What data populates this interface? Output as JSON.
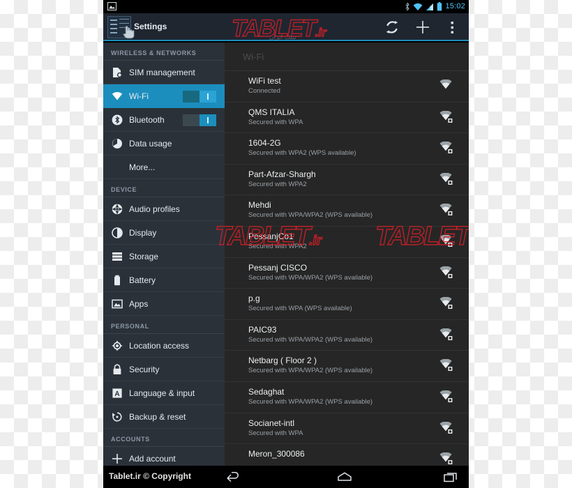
{
  "status_bar": {
    "notification_icon": "image-icon",
    "icons": [
      "bluetooth-icon",
      "wifi-icon",
      "signal-icon",
      "battery-icon"
    ],
    "clock": "15:02"
  },
  "action_bar": {
    "app_icon": "settings-app-icon",
    "title": "Settings",
    "buttons": [
      {
        "name": "scan-button",
        "icon": "refresh-scan-icon"
      },
      {
        "name": "add-network-button",
        "icon": "plus-icon"
      },
      {
        "name": "overflow-menu-button",
        "icon": "more-vertical-icon"
      }
    ]
  },
  "sidebar": {
    "sections": [
      {
        "header": "WIRELESS & NETWORKS",
        "items": [
          {
            "label": "SIM management",
            "icon": "sim-card-icon",
            "selected": false,
            "toggle": null
          },
          {
            "label": "Wi-Fi",
            "icon": "wifi-icon",
            "selected": true,
            "toggle": "on"
          },
          {
            "label": "Bluetooth",
            "icon": "bluetooth-icon",
            "selected": false,
            "toggle": "on"
          },
          {
            "label": "Data usage",
            "icon": "pie-chart-icon",
            "selected": false,
            "toggle": null
          },
          {
            "label": "More...",
            "icon": null,
            "selected": false,
            "toggle": null
          }
        ]
      },
      {
        "header": "DEVICE",
        "items": [
          {
            "label": "Audio profiles",
            "icon": "audio-profiles-icon",
            "selected": false,
            "toggle": null
          },
          {
            "label": "Display",
            "icon": "brightness-icon",
            "selected": false,
            "toggle": null
          },
          {
            "label": "Storage",
            "icon": "storage-icon",
            "selected": false,
            "toggle": null
          },
          {
            "label": "Battery",
            "icon": "battery-icon",
            "selected": false,
            "toggle": null
          },
          {
            "label": "Apps",
            "icon": "apps-image-icon",
            "selected": false,
            "toggle": null
          }
        ]
      },
      {
        "header": "PERSONAL",
        "items": [
          {
            "label": "Location access",
            "icon": "location-crosshair-icon",
            "selected": false,
            "toggle": null
          },
          {
            "label": "Security",
            "icon": "lock-icon",
            "selected": false,
            "toggle": null
          },
          {
            "label": "Language & input",
            "icon": "language-a-icon",
            "selected": false,
            "toggle": null
          },
          {
            "label": "Backup & reset",
            "icon": "backup-restore-icon",
            "selected": false,
            "toggle": null
          }
        ]
      },
      {
        "header": "ACCOUNTS",
        "items": [
          {
            "label": "Add account",
            "icon": "plus-icon",
            "selected": false,
            "toggle": null
          }
        ]
      }
    ]
  },
  "content": {
    "title": "Wi-Fi",
    "networks": [
      {
        "ssid": "WiFi test",
        "status": "Connected",
        "signal": "wifi-signal-icon"
      },
      {
        "ssid": "QMS ITALIA",
        "status": "Secured with WPA",
        "signal": "wifi-signal-lock-icon"
      },
      {
        "ssid": "1604-2G",
        "status": "Secured with WPA2 (WPS available)",
        "signal": "wifi-signal-lock-icon"
      },
      {
        "ssid": "Part-Afzar-Shargh",
        "status": "Secured with WPA2",
        "signal": "wifi-signal-lock-icon"
      },
      {
        "ssid": "Mehdi",
        "status": "Secured with WPA/WPA2 (WPS available)",
        "signal": "wifi-signal-lock-icon"
      },
      {
        "ssid": "PessanjCo1",
        "status": "Secured with WPA2",
        "signal": "wifi-signal-lock-icon"
      },
      {
        "ssid": "Pessanj CISCO",
        "status": "Secured with WPA/WPA2 (WPS available)",
        "signal": "wifi-signal-lock-icon"
      },
      {
        "ssid": "p.g",
        "status": "Secured with WPA (WPS available)",
        "signal": "wifi-signal-lock-icon"
      },
      {
        "ssid": "PAIC93",
        "status": "Secured with WPA/WPA2 (WPS available)",
        "signal": "wifi-signal-lock-icon"
      },
      {
        "ssid": "Netbarg ( Floor 2 )",
        "status": "Secured with WPA/WPA2 (WPS available)",
        "signal": "wifi-signal-lock-icon"
      },
      {
        "ssid": "Sedaghat",
        "status": "Secured with WPA/WPA2 (WPS available)",
        "signal": "wifi-signal-lock-icon"
      },
      {
        "ssid": "Socianet-intl",
        "status": "Secured with WPA",
        "signal": "wifi-signal-lock-icon"
      },
      {
        "ssid": "Meron_300086",
        "status": "",
        "signal": "wifi-signal-lock-icon"
      }
    ]
  },
  "bottom_bar": {
    "copyright": "Tablet.ir © Copyright",
    "nav": [
      {
        "name": "nav-back-button",
        "icon": "back-arrow-icon"
      },
      {
        "name": "nav-home-button",
        "icon": "home-icon"
      },
      {
        "name": "nav-recent-button",
        "icon": "recent-apps-icon"
      }
    ]
  },
  "watermark": {
    "text": "TABLET",
    "suffix": ".ir",
    "subtitle": "تبلت ایران",
    "color": "#d62027"
  },
  "colors": {
    "accent": "#1b8ebd",
    "sidebar_bg": "#2b3139",
    "content_bg": "#262626",
    "actionbar_bg": "#1f2630",
    "clock": "#4fc3f7"
  }
}
